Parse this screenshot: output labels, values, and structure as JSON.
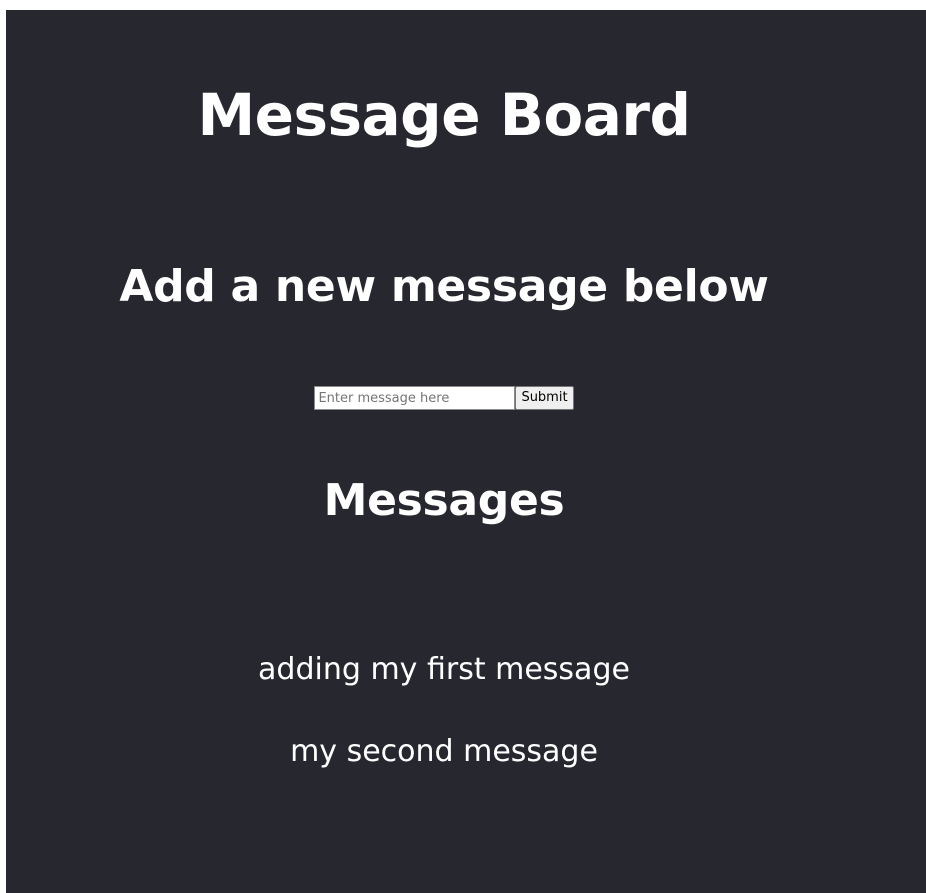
{
  "header": {
    "title": "Message Board"
  },
  "form": {
    "heading": "Add a new message below",
    "input_placeholder": "Enter message here",
    "input_value": "",
    "submit_label": "Submit"
  },
  "messages": {
    "heading": "Messages",
    "items": [
      {
        "text": "adding my first message"
      },
      {
        "text": "my second message"
      }
    ]
  },
  "colors": {
    "background": "#272730",
    "text": "#ffffff"
  }
}
